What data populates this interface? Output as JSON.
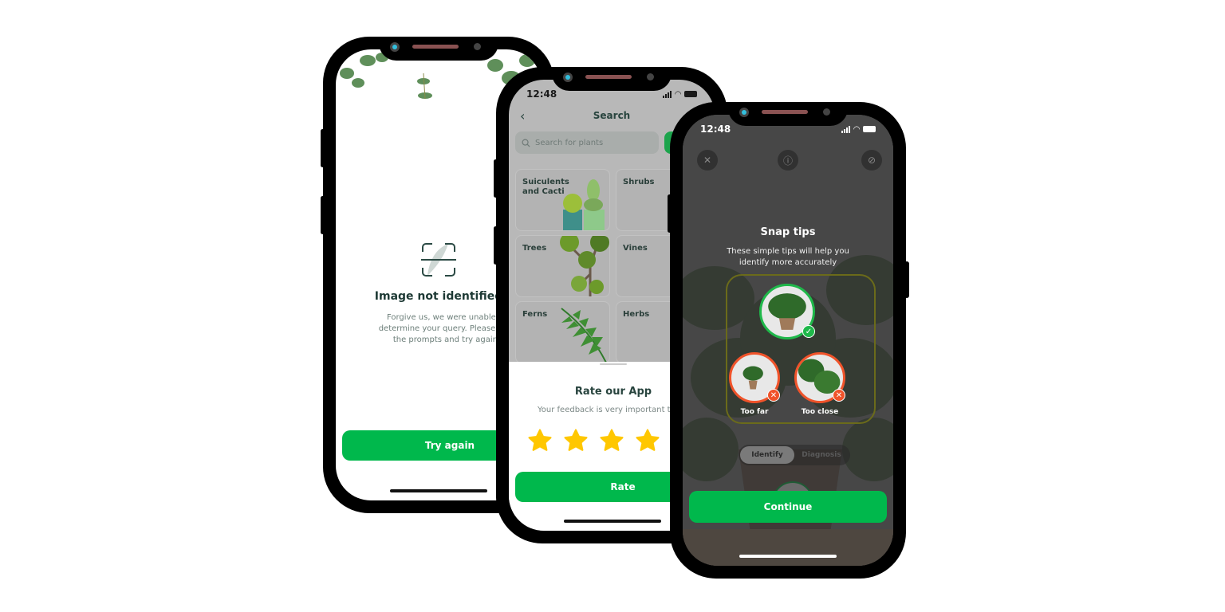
{
  "phones": {
    "not_identified": {
      "title": "Image not identified",
      "description": "Forgive us, we were unable to\ndetermine your query. Please look\nthe prompts and try again.",
      "button_label": "Try again",
      "icon": "scan-leaf-icon"
    },
    "search": {
      "status_time": "12:48",
      "header_title": "Search",
      "back_icon": "chevron-left-icon",
      "search_placeholder": "Search for plants",
      "categories": [
        {
          "label": "Suiculents\nand Cacti"
        },
        {
          "label": "Shrubs"
        },
        {
          "label": "Trees"
        },
        {
          "label": "Vines"
        },
        {
          "label": "Ferns"
        },
        {
          "label": "Herbs"
        }
      ],
      "rate_sheet": {
        "title": "Rate our App",
        "subtitle": "Your feedback is very important to",
        "stars_visible": 4,
        "rating_selected": 4,
        "button_label": "Rate"
      }
    },
    "snap_tips": {
      "status_time": "12:48",
      "title": "Snap tips",
      "description": "These simple tips will help you\nidentify more accurately",
      "tips": [
        {
          "label": "",
          "status": "good",
          "badge_icon": "check-icon"
        },
        {
          "label": "Too far",
          "status": "bad",
          "badge_icon": "close-icon"
        },
        {
          "label": "Too close",
          "status": "bad",
          "badge_icon": "close-icon"
        }
      ],
      "modes": [
        "Identify",
        "Diagnosis"
      ],
      "active_mode": "Identify",
      "button_label": "Continue"
    }
  },
  "colors": {
    "primary_green": "#00b84c",
    "good": "#1fb84a",
    "bad": "#f0532a",
    "star": "#ffc700",
    "text_dark": "#1e3a35"
  }
}
